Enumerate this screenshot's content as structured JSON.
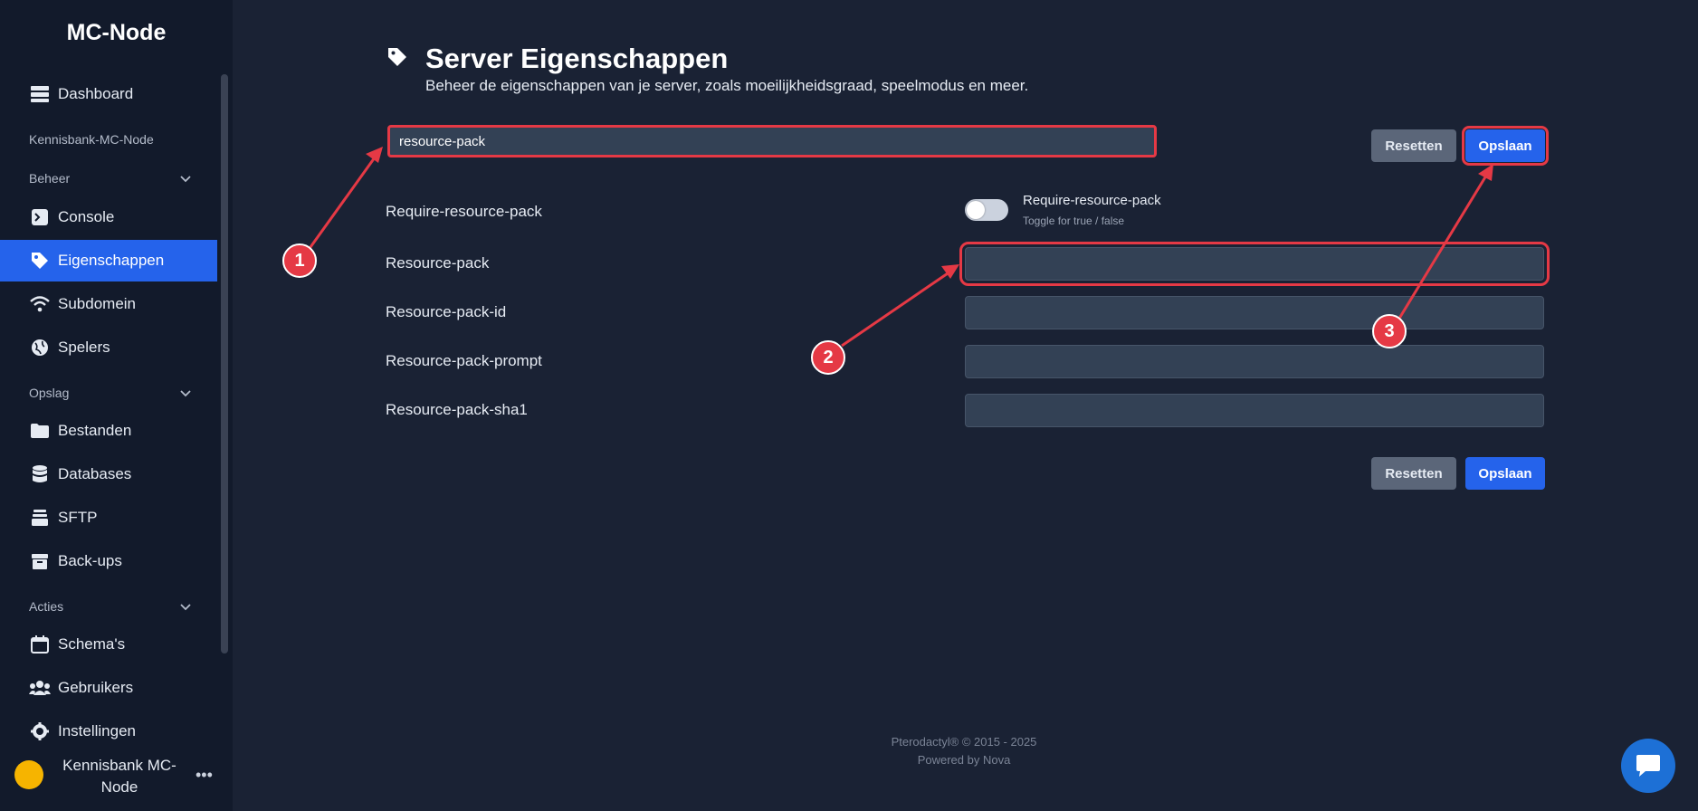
{
  "app": {
    "brand": "MC-Node"
  },
  "sidebar": {
    "items": [
      {
        "label": "Dashboard",
        "icon": "server-icon"
      },
      {
        "label": "Console",
        "icon": "terminal-icon"
      },
      {
        "label": "Eigenschappen",
        "icon": "tag-icon",
        "active": true
      },
      {
        "label": "Subdomein",
        "icon": "wifi-icon"
      },
      {
        "label": "Spelers",
        "icon": "globe-icon"
      },
      {
        "label": "Bestanden",
        "icon": "folder-icon"
      },
      {
        "label": "Databases",
        "icon": "database-icon"
      },
      {
        "label": "SFTP",
        "icon": "layers-icon"
      },
      {
        "label": "Back-ups",
        "icon": "archive-icon"
      },
      {
        "label": "Schema's",
        "icon": "calendar-icon"
      },
      {
        "label": "Gebruikers",
        "icon": "users-icon"
      },
      {
        "label": "Instellingen",
        "icon": "gear-icon"
      }
    ],
    "sections": {
      "kennisbank": "Kennisbank-MC-Node",
      "beheer": "Beheer",
      "opslag": "Opslag",
      "acties": "Acties"
    },
    "user": {
      "name": "Kennisbank MC-Node"
    }
  },
  "page": {
    "title": "Server Eigenschappen",
    "subtitle": "Beheer de eigenschappen van je server, zoals moeilijkheidsgraad, speelmodus en meer."
  },
  "search": {
    "value": "resource-pack"
  },
  "buttons": {
    "reset": "Resetten",
    "save": "Opslaan"
  },
  "properties": [
    {
      "label": "Require-resource-pack",
      "type": "toggle",
      "value": false,
      "toggle_label": "Require-resource-pack",
      "toggle_hint": "Toggle for true / false"
    },
    {
      "label": "Resource-pack",
      "type": "text",
      "value": ""
    },
    {
      "label": "Resource-pack-id",
      "type": "text",
      "value": ""
    },
    {
      "label": "Resource-pack-prompt",
      "type": "text",
      "value": ""
    },
    {
      "label": "Resource-pack-sha1",
      "type": "text",
      "value": ""
    }
  ],
  "annotations": {
    "marker1": "1",
    "marker2": "2",
    "marker3": "3"
  },
  "footer": {
    "line1": "Pterodactyl® © 2015 - 2025",
    "line2": "Powered by Nova"
  },
  "colors": {
    "accent": "#2563eb",
    "annotation": "#e53945",
    "sidebar_bg": "#121a2b",
    "main_bg": "#1a2234"
  }
}
